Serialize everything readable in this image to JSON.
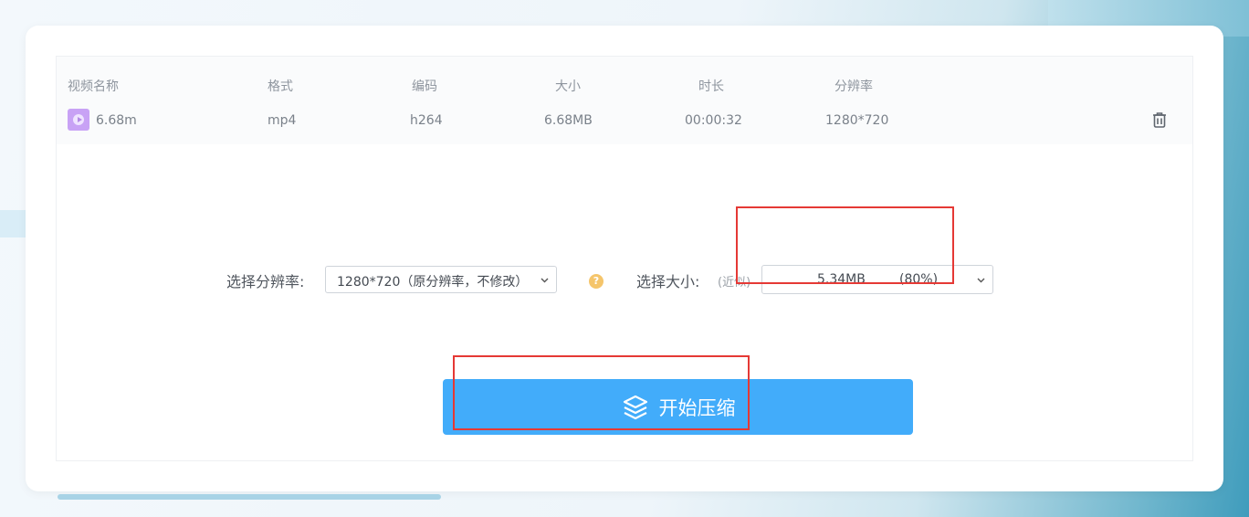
{
  "table": {
    "headers": {
      "name": "视频名称",
      "format": "格式",
      "codec": "编码",
      "size": "大小",
      "duration": "时长",
      "resolution": "分辨率"
    },
    "row": {
      "name": "6.68m",
      "format": "mp4",
      "codec": "h264",
      "size": "6.68MB",
      "duration": "00:00:32",
      "resolution": "1280*720"
    }
  },
  "options": {
    "resolution_label": "选择分辨率:",
    "resolution_value": "1280*720（原分辨率，不修改）",
    "help_symbol": "?",
    "size_label": "选择大小:",
    "size_hint": "(近似)",
    "size_value": "5.34MB",
    "size_percent": "(80%)"
  },
  "action": {
    "start_label": "开始压缩"
  },
  "icons": {
    "file": "video-file-icon",
    "delete": "trash-icon",
    "help": "help-icon",
    "start": "layers-icon"
  },
  "colors": {
    "primary_button": "#42acfa",
    "highlight_box": "#e53935",
    "help_badge": "#f5c56b",
    "file_icon": "#c8a2f5"
  }
}
